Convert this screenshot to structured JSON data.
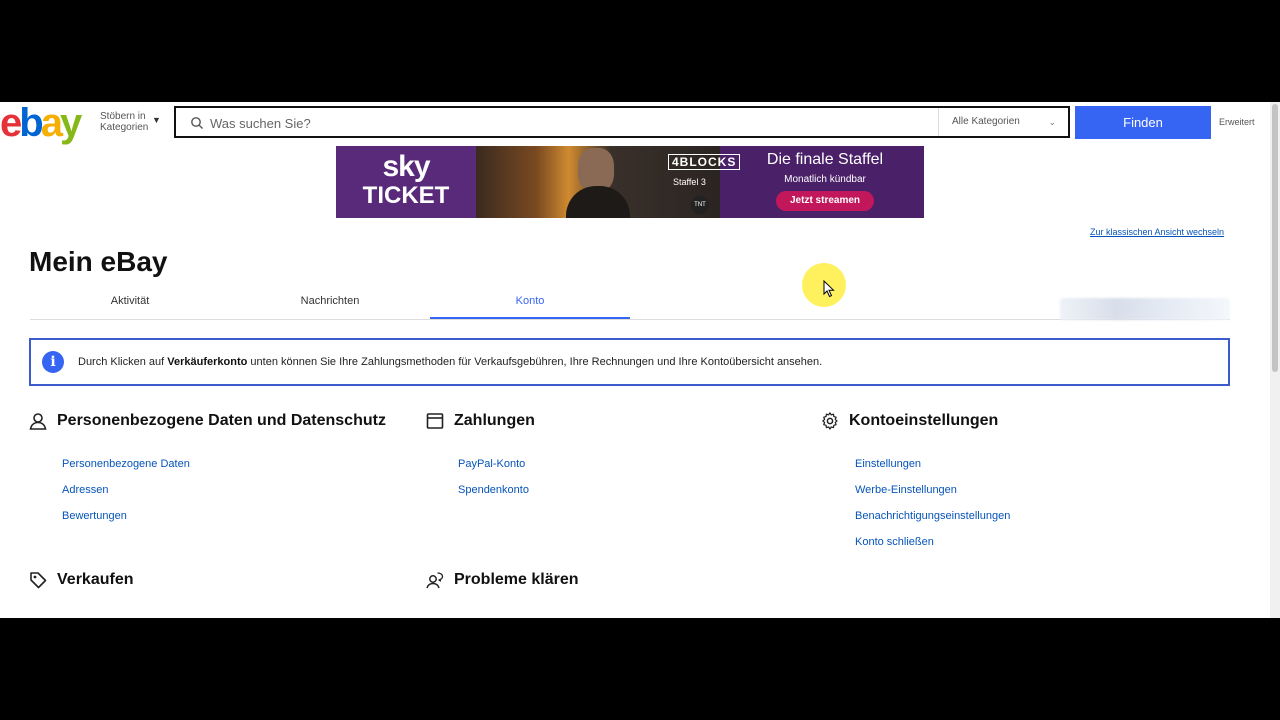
{
  "header": {
    "logo_letters": [
      "e",
      "b",
      "a",
      "y"
    ],
    "logo_colors": [
      "#e53238",
      "#0064d2",
      "#f5af02",
      "#86b817"
    ],
    "shop_by_line1": "Stöbern in",
    "shop_by_line2": "Kategorien",
    "search_placeholder": "Was suchen Sie?",
    "category_select": "Alle Kategorien",
    "find_button": "Finden",
    "advanced_link": "Erweitert"
  },
  "banner": {
    "brand_line1": "sky",
    "brand_line2": "TICKET",
    "show": "4BLOCKS",
    "season": "Staffel 3",
    "network": "TNT",
    "headline": "Die finale Staffel",
    "subline": "Monatlich kündbar",
    "cta": "Jetzt streamen"
  },
  "classic_link": "Zur klassischen Ansicht wechseln",
  "page_title": "Mein eBay",
  "tabs": [
    {
      "label": "Aktivität",
      "active": false
    },
    {
      "label": "Nachrichten",
      "active": false
    },
    {
      "label": "Konto",
      "active": true
    }
  ],
  "info": {
    "pre": "Durch Klicken auf ",
    "bold": "Verkäuferkonto",
    "post": " unten können Sie Ihre Zahlungsmethoden für Verkaufsgebühren, Ihre Rechnungen und Ihre Kontoübersicht ansehen."
  },
  "sections": {
    "personal": {
      "title": "Personenbezogene Daten und Datenschutz",
      "icon": "person-icon",
      "links": [
        "Personenbezogene Daten",
        "Adressen",
        "Bewertungen"
      ]
    },
    "payments": {
      "title": "Zahlungen",
      "icon": "card-icon",
      "links": [
        "PayPal-Konto",
        "Spendenkonto"
      ]
    },
    "settings": {
      "title": "Kontoeinstellungen",
      "icon": "gear-icon",
      "links": [
        "Einstellungen",
        "Werbe-Einstellungen",
        "Benachrichtigungseinstellungen",
        "Konto schließen"
      ]
    },
    "selling": {
      "title": "Verkaufen",
      "icon": "tag-icon"
    },
    "problems": {
      "title": "Probleme klären",
      "icon": "support-icon"
    }
  }
}
